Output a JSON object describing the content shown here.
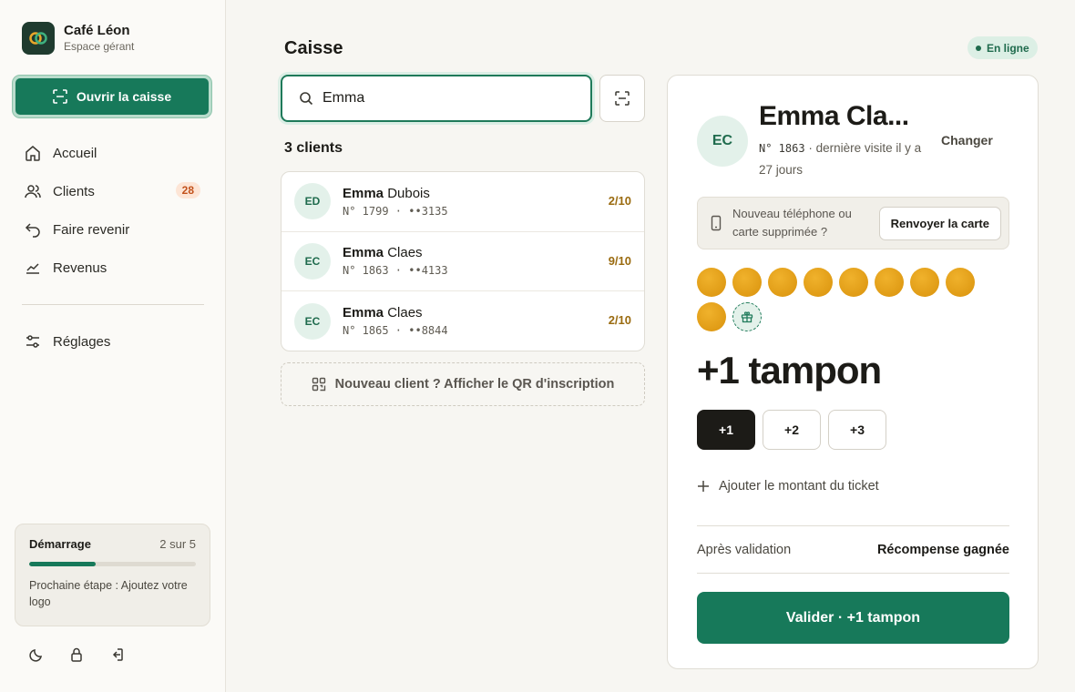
{
  "brand": {
    "name": "Café Léon",
    "subtitle": "Espace gérant"
  },
  "sidebar": {
    "open_register_label": "Ouvrir la caisse",
    "items": [
      {
        "label": "Accueil",
        "icon": "home-icon"
      },
      {
        "label": "Clients",
        "icon": "users-icon",
        "badge": "28"
      },
      {
        "label": "Faire revenir",
        "icon": "return-arrow-icon"
      },
      {
        "label": "Revenus",
        "icon": "trend-chart-icon"
      }
    ],
    "settings": {
      "label": "Réglages",
      "icon": "sliders-icon"
    },
    "onboarding": {
      "title": "Démarrage",
      "count": "2 sur 5",
      "progress": 0.4,
      "next_step": "Prochaine étape : Ajoutez votre logo"
    },
    "bottom_icons": [
      "moon-icon",
      "lock-icon",
      "logout-icon"
    ]
  },
  "main": {
    "title": "Caisse",
    "status": "En ligne",
    "search": {
      "value": "Emma"
    },
    "results_count": "3 clients",
    "clients": [
      {
        "initials": "ED",
        "first": "Emma",
        "last": " Dubois",
        "meta": "N° 1799 · ••3135",
        "score": "2/10"
      },
      {
        "initials": "EC",
        "first": "Emma",
        "last": " Claes",
        "meta": "N° 1863 · ••4133",
        "score": "9/10"
      },
      {
        "initials": "EC",
        "first": "Emma",
        "last": " Claes",
        "meta": "N° 1865 · ••8844",
        "score": "2/10"
      }
    ],
    "new_client_label": "Nouveau client ? Afficher le QR d'inscription"
  },
  "panel": {
    "initials": "EC",
    "name": "Emma Cla...",
    "number": "N° 1863",
    "last_visit": " · dernière visite il y a 27 jours",
    "change_label": "Changer",
    "resend_text": "Nouveau téléphone ou carte supprimée ?",
    "resend_button": "Renvoyer la carte",
    "stamps_filled": 9,
    "stamps_total": 10,
    "action_label": "+1 tampon",
    "quantities": [
      "+1",
      "+2",
      "+3"
    ],
    "selected_quantity": "+1",
    "add_amount_label": "Ajouter le montant du ticket",
    "after_label": "Après validation",
    "after_value": "Récompense gagnée",
    "validate_label": "Valider · +1 tampon"
  },
  "colors": {
    "accent": "#17795a",
    "stamp": "#e4a01a",
    "badge": "#c2521c"
  }
}
